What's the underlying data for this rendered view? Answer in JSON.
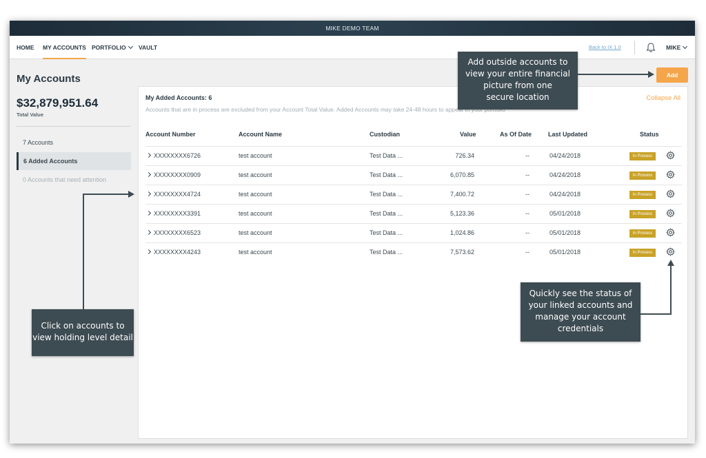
{
  "app": {
    "team_name": "MIKE DEMO TEAM"
  },
  "nav": {
    "items": [
      {
        "label": "HOME"
      },
      {
        "label": "MY ACCOUNTS"
      },
      {
        "label": "PORTFOLIO"
      },
      {
        "label": "VAULT"
      }
    ],
    "back_link": "Back to IX 1.0",
    "user": "MIKE"
  },
  "summary": {
    "title": "My Accounts",
    "total_value": "$32,879,951.64",
    "total_label": "Total Value"
  },
  "sidebar": {
    "items": [
      {
        "label": "7 Accounts"
      },
      {
        "label": "6 Added Accounts"
      },
      {
        "label": "0 Accounts that need attention"
      }
    ]
  },
  "add_button": "Add",
  "panel": {
    "title": "My Added Accounts: 6",
    "subtitle": "Accounts that are in process are excluded from your Account Total Value. Added Accounts may take 24-48 hours to appear in your portfolio",
    "collapse_label": "Collapse All"
  },
  "table": {
    "columns": [
      "Account Number",
      "Account Name",
      "Custodian",
      "Value",
      "As Of Date",
      "Last Updated",
      "Status"
    ],
    "rows": [
      {
        "number": "XXXXXXXX6726",
        "name": "test account",
        "custodian": "Test Data ...",
        "value": "726.34",
        "as_of": "--",
        "updated": "04/24/2018",
        "status": "In Process"
      },
      {
        "number": "XXXXXXXX0909",
        "name": "test account",
        "custodian": "Test Data ...",
        "value": "6,070.85",
        "as_of": "--",
        "updated": "04/24/2018",
        "status": "In Process"
      },
      {
        "number": "XXXXXXXX4724",
        "name": "test account",
        "custodian": "Test Data ...",
        "value": "7,400.72",
        "as_of": "--",
        "updated": "04/24/2018",
        "status": "In Process"
      },
      {
        "number": "XXXXXXXX3391",
        "name": "test account",
        "custodian": "Test Data ...",
        "value": "5,123.36",
        "as_of": "--",
        "updated": "05/01/2018",
        "status": "In Process"
      },
      {
        "number": "XXXXXXXX6523",
        "name": "test account",
        "custodian": "Test Data ...",
        "value": "1,024.86",
        "as_of": "--",
        "updated": "05/01/2018",
        "status": "In Process"
      },
      {
        "number": "XXXXXXXX4243",
        "name": "test account",
        "custodian": "Test Data ...",
        "value": "7,573.62",
        "as_of": "--",
        "updated": "05/01/2018",
        "status": "In Process"
      }
    ]
  },
  "callouts": {
    "add_tip": [
      "Add outside accounts to",
      "view your entire financial",
      "picture from one",
      "secure location"
    ],
    "status_tip": [
      "Quickly see the status of",
      "your linked accounts and",
      "manage your account",
      "credentials"
    ],
    "click_tip": [
      "Click on accounts to",
      "view holding level detail"
    ]
  },
  "icons": {
    "nav_dropdown": "chevron-down-icon",
    "notifications": "bell-icon",
    "row_expand": "chevron-right-icon",
    "row_settings": "gear-icon"
  },
  "colors": {
    "accent": "#f5a54a",
    "status_badge": "#c9a227",
    "topbar": "#1d2c38",
    "callout": "#3d4b52",
    "link": "#6fa6cf"
  }
}
